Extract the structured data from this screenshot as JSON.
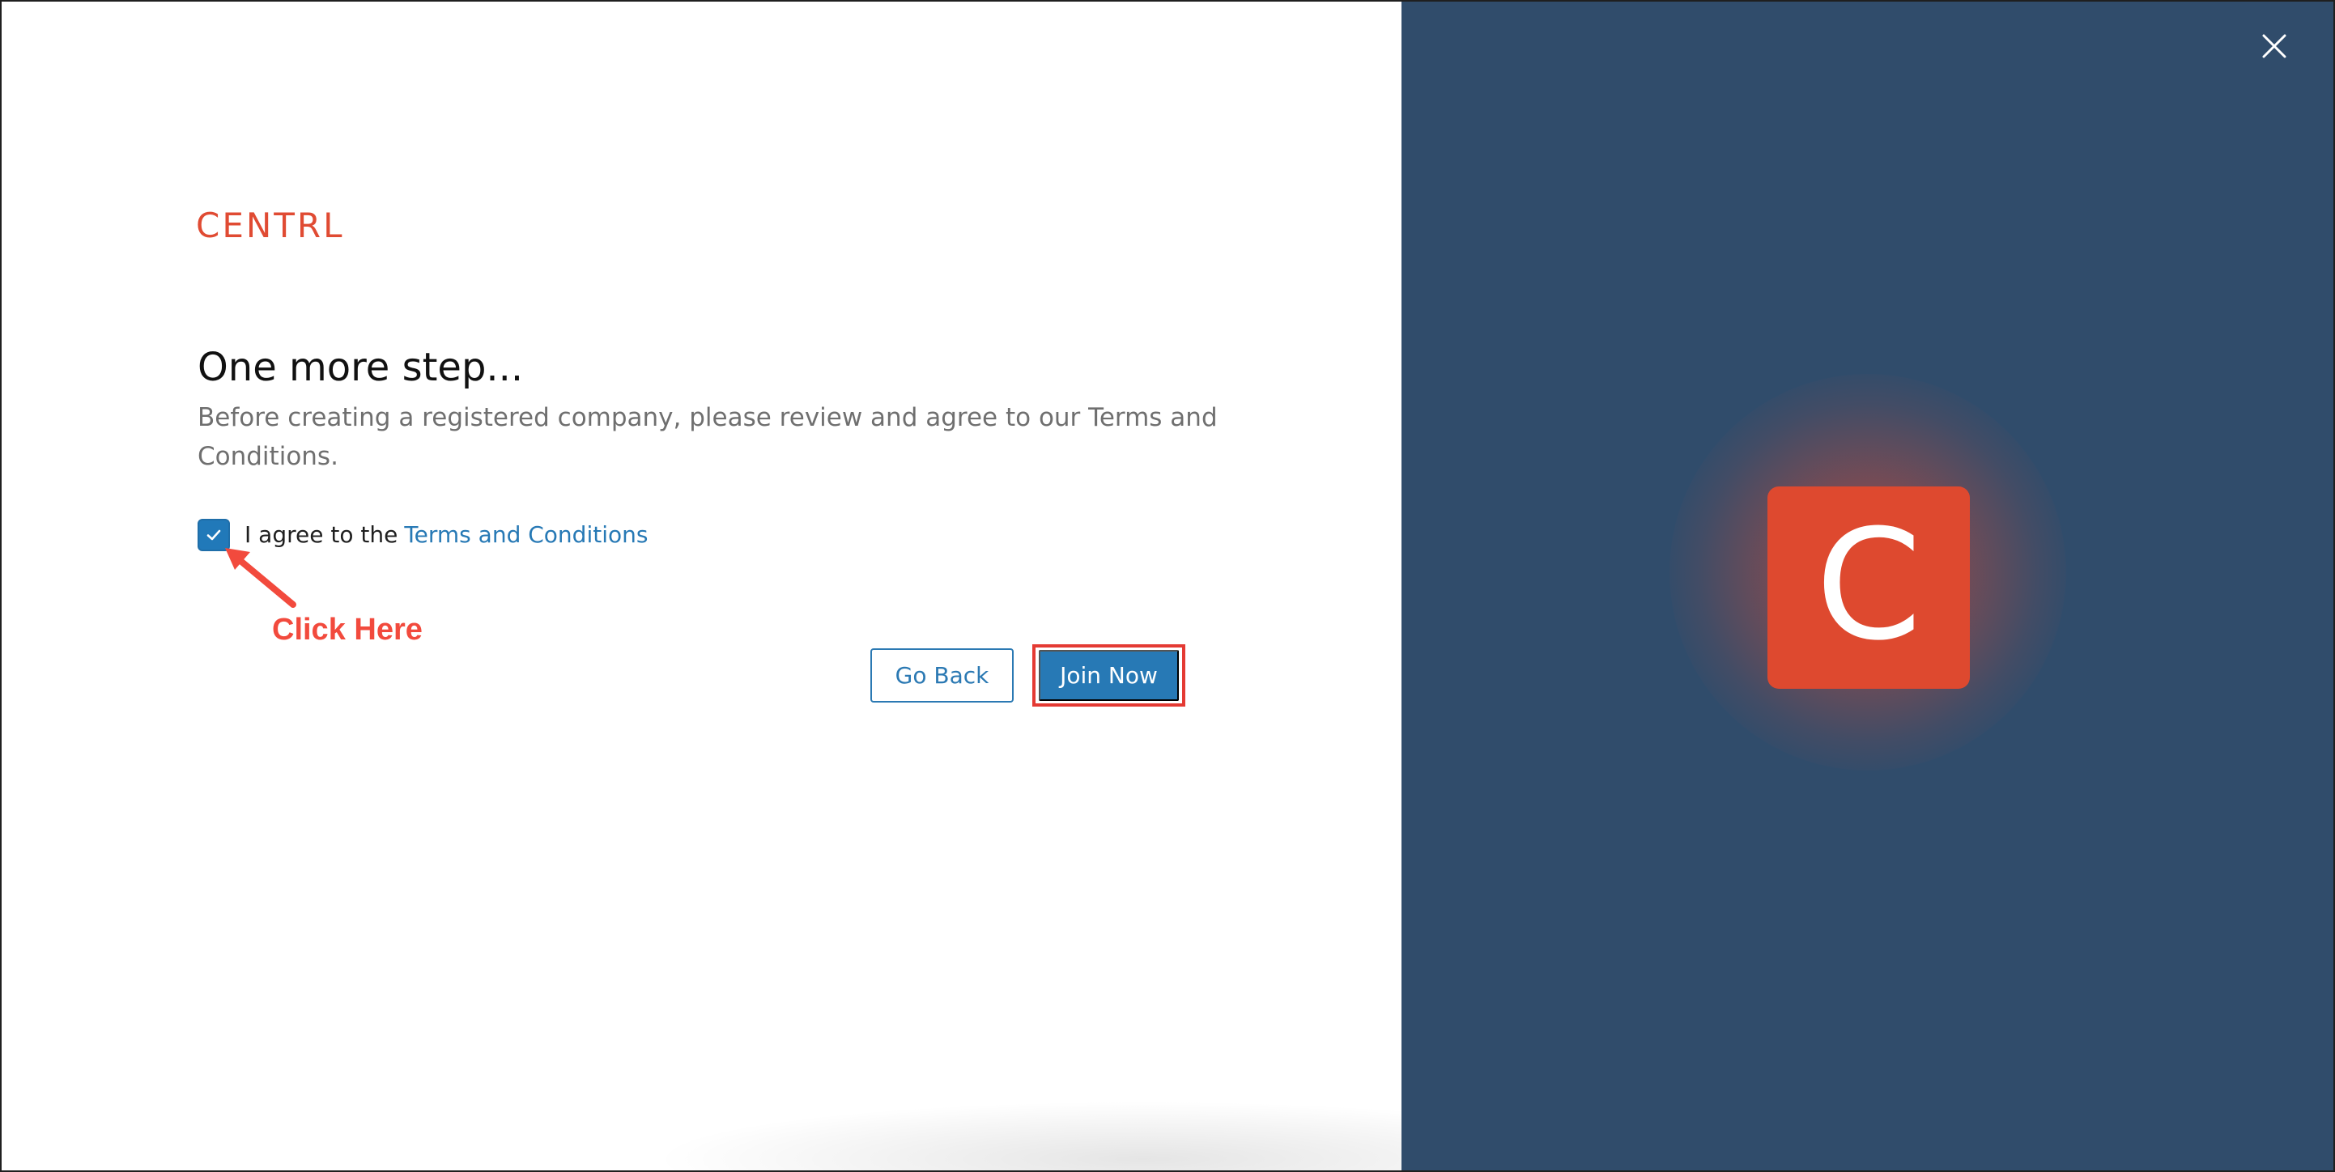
{
  "brand": {
    "wordmark": "CENTRL",
    "mark_letter": "C",
    "accent_color": "#e04b33"
  },
  "modal": {
    "title": "One more step...",
    "description": "Before creating a registered company, please review and agree to our Terms and Conditions.",
    "terms": {
      "checked": true,
      "prefix": "I agree to the",
      "link_text": "Terms and Conditions"
    },
    "buttons": {
      "back_label": "Go Back",
      "join_label": "Join Now"
    }
  },
  "annotation": {
    "label": "Click Here",
    "color": "#f24a3d"
  },
  "icons": {
    "close": "close-icon",
    "check": "check-icon"
  },
  "colors": {
    "panel_background": "#304c6b",
    "primary_button": "#2779b5",
    "highlight_border": "#e43a33"
  }
}
